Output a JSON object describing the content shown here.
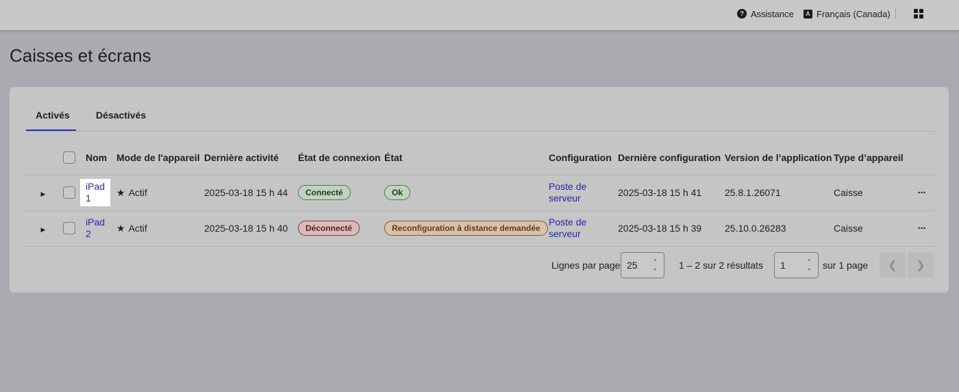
{
  "topbar": {
    "assistance_label": "Assistance",
    "language_label": "Français (Canada)",
    "help_icon": "question-circle-icon",
    "language_icon": "translate-icon",
    "apps_icon": "grid-apps-icon"
  },
  "page": {
    "title": "Caisses et écrans"
  },
  "tabs": [
    {
      "label": "Activés",
      "active": true
    },
    {
      "label": "Désactivés",
      "active": false
    }
  ],
  "table": {
    "headers": {
      "name": "Nom",
      "mode": "Mode de l'appareil",
      "last_activity": "Dernière activité",
      "connection": "État de connexion",
      "state": "État",
      "configuration": "Configuration",
      "last_configuration": "Dernière configuration",
      "app_version": "Version de l’application",
      "device_type": "Type d’appareil"
    },
    "rows": [
      {
        "name_line1": "iPad",
        "name_line2": "1",
        "mode": "Actif",
        "last_activity": "2025-03-18 15 h 44",
        "connection": "Connecté",
        "state": "Ok",
        "config_line1": "Poste de",
        "config_line2": "serveur",
        "last_configuration": "2025-03-18 15 h 41",
        "app_version": "25.8.1.26071",
        "device_type": "Caisse",
        "more": "···"
      },
      {
        "name_line1": "iPad",
        "name_line2": "2",
        "mode": "Actif",
        "last_activity": "2025-03-18 15 h 40",
        "connection": "Déconnecté",
        "state": "Reconfiguration à distance demandée",
        "config_line1": "Poste de",
        "config_line2": "serveur",
        "last_configuration": "2025-03-18 15 h 39",
        "app_version": "25.10.0.26283",
        "device_type": "Caisse",
        "more": "···"
      }
    ]
  },
  "pagination": {
    "rows_per_page_label": "Lignes par page",
    "rows_per_page_value": "25",
    "results_label": "1 – 2 sur 2 résultats",
    "page_value": "1",
    "of_pages_label": "sur 1 page"
  },
  "colors": {
    "link": "#2626a8",
    "connected": "#4a7a4a",
    "disconnected": "#8a3434",
    "reconfig": "#8e5420"
  }
}
